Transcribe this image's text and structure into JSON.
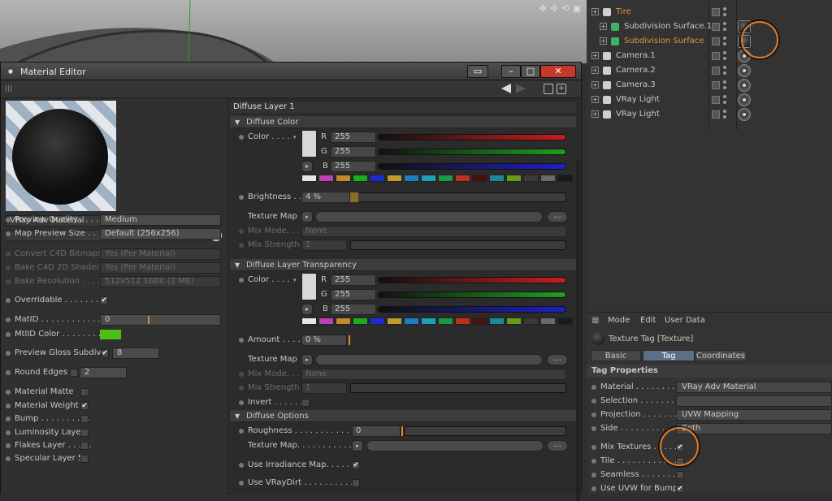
{
  "viewport": {
    "icons": [
      "move-icon",
      "zoom-icon",
      "rotate-icon",
      "maximize-icon"
    ],
    "icon_glyphs": [
      "✥",
      "✣",
      "⟲",
      "▣"
    ]
  },
  "object_manager": {
    "rows": [
      {
        "name": "Tire",
        "color": "#e0953c",
        "indent": 0
      },
      {
        "name": "Subdivision Surface.1",
        "color": "#c9c9c9",
        "indent": 1
      },
      {
        "name": "Subdivision Surface",
        "color": "#e0953c",
        "indent": 1
      },
      {
        "name": "Camera.1",
        "color": "#c9c9c9",
        "indent": 0
      },
      {
        "name": "Camera.2",
        "color": "#c9c9c9",
        "indent": 0
      },
      {
        "name": "Camera.3",
        "color": "#c9c9c9",
        "indent": 0
      },
      {
        "name": "VRay Light",
        "color": "#c9c9c9",
        "indent": 0
      },
      {
        "name": "VRay Light",
        "color": "#c9c9c9",
        "indent": 0
      }
    ]
  },
  "attribute_manager": {
    "menu": [
      "Mode",
      "Edit",
      "User Data"
    ],
    "header": "Texture Tag [Texture]",
    "tabs": [
      "Basic",
      "Tag",
      "Coordinates"
    ],
    "active_tab": "Tag",
    "section": "Tag Properties",
    "rows": [
      {
        "label": "Material . . . . . . . .",
        "value": "VRay Adv Material"
      },
      {
        "label": "Selection . . . . . . . .",
        "value": ""
      },
      {
        "label": "Projection . . . . . . .",
        "value": "UVW Mapping"
      },
      {
        "label": "Side . . . . . . . . . . .",
        "value": "Both"
      },
      {
        "label": "Mix Textures . . . . .",
        "value": "✔"
      },
      {
        "label": "Tile . . . . . . . . . . . .",
        "value": ""
      },
      {
        "label": "Seamless . . . . . . . .",
        "value": ""
      },
      {
        "label": "Use UVW for Bump",
        "value": "✔"
      }
    ]
  },
  "material_editor": {
    "title": "Material Editor",
    "material_name": "VRay Adv Material",
    "left_rows": [
      {
        "label": "Preview Quality . . . . .",
        "value": "Medium",
        "dim": false
      },
      {
        "label": "Map Preview Size . .",
        "value": "Default (256x256)",
        "dim": false
      },
      {
        "label": "Convert C4D Bitmaps",
        "value": "Yes (Per Material)",
        "dim": true
      },
      {
        "label": "Bake C4D 2D Shaders",
        "value": "Yes (Per Material)",
        "dim": true
      },
      {
        "label": "Bake Resolution . . . .",
        "value": "512x512   16Bit   (2 MB)",
        "dim": true
      },
      {
        "label": "Overridable . . . . . . . . .",
        "value": "✔",
        "dim": false
      },
      {
        "label": "MatID . . . . . . . . . . . . .",
        "value": "0",
        "dim": false
      },
      {
        "label": "MtlID Color . . . . . . . .",
        "value": "",
        "dim": false
      },
      {
        "label": "Preview Gloss Subdivs",
        "value": "8",
        "dim": false
      },
      {
        "label": "Round Edges",
        "value": "2",
        "dim": false
      },
      {
        "label": "Material Matte",
        "value": "",
        "dim": false
      },
      {
        "label": "Material Weight",
        "value": "✔",
        "dim": false
      },
      {
        "label": "Bump . . . . . . . . . .",
        "value": "",
        "dim": false
      },
      {
        "label": "Luminosity Layer",
        "value": "",
        "dim": false
      },
      {
        "label": "Flakes Layer . . . . .",
        "value": "",
        "dim": false
      },
      {
        "label": "Specular Layer 5",
        "value": "",
        "dim": false
      }
    ],
    "mtlid_color": "#4fbf1a",
    "right": {
      "layer_title": "Diffuse Layer 1",
      "diffuse_color": {
        "section": "Diffuse Color",
        "color_label": "Color . . . .",
        "r_label": "R",
        "r": "255",
        "g_label": "G",
        "g": "255",
        "b_label": "B",
        "b": "255",
        "brightness_label": "Brightness . .",
        "brightness": "4 %",
        "texture_label": "Texture Map",
        "texture_button": "...",
        "mix_mode_label": "Mix Mode. . .",
        "mix_mode": "None",
        "mix_strength_label": "Mix Strength",
        "mix_strength": "1"
      },
      "transparency": {
        "section": "Diffuse Layer Transparency",
        "color_label": "Color . . . .",
        "r_label": "R",
        "r": "255",
        "g_label": "G",
        "g": "255",
        "b_label": "B",
        "b": "255",
        "amount_label": "Amount . . . .",
        "amount": "0 %",
        "texture_label": "Texture Map",
        "texture_button": "...",
        "mix_mode_label": "Mix Mode. . .",
        "mix_mode": "None",
        "mix_strength_label": "Mix Strength",
        "mix_strength": "1",
        "invert_label": "Invert . . . . . ."
      },
      "options": {
        "section": "Diffuse Options",
        "roughness_label": "Roughness . . . . . . . . . . .",
        "roughness": "0",
        "texture_label": "Texture Map. . . . . . . . . . .",
        "texture_button": "...",
        "irradiance_label": "Use Irradiance Map. . . . . .",
        "irradiance": "✔",
        "vraydirt_label": "Use VRayDirt . . . . . . . . . .",
        "vraydirt": ""
      },
      "swatches": [
        "#e6e6e6",
        "#c13fb6",
        "#c08a2a",
        "#1aae1a",
        "#1a2bd6",
        "#c09a2a",
        "#1a7fbf",
        "#1aa0b8",
        "#1a9a45",
        "#c0301a",
        "#4a1010",
        "#1a8a9a",
        "#6a9a1a",
        "#3a3a3a",
        "#6a6a6a",
        "#1a1a1a"
      ]
    }
  }
}
